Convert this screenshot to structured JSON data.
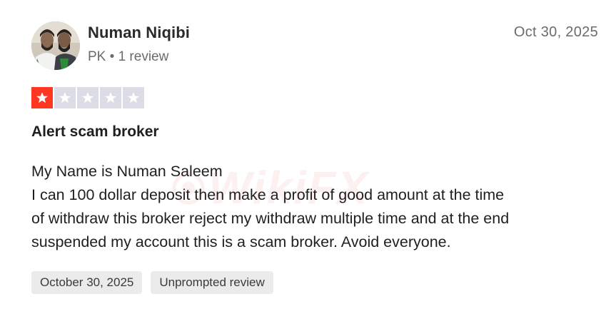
{
  "reviewer": {
    "name": "Numan Niqibi",
    "country": "PK",
    "review_count": "1 review",
    "avatar_icon": "user-photo-icon"
  },
  "review": {
    "date": "Oct 30, 2025",
    "rating": 1,
    "rating_max": 5,
    "title": "Alert scam broker",
    "body_lines": [
      "My Name is Numan Saleem",
      "I can 100 dollar deposit then make a profit of good amount at the time",
      "of withdraw this broker reject my withdraw multiple time and at the end",
      "suspended my account this is a scam broker. Avoid everyone."
    ],
    "tags": [
      "October 30, 2025",
      "Unprompted review"
    ]
  },
  "watermark": {
    "text": "WikiFX"
  },
  "colors": {
    "star_filled": "#ff3722",
    "star_empty": "#dcdce6",
    "tag_bg": "#ebebeb",
    "muted_text": "#6b6b6b"
  }
}
